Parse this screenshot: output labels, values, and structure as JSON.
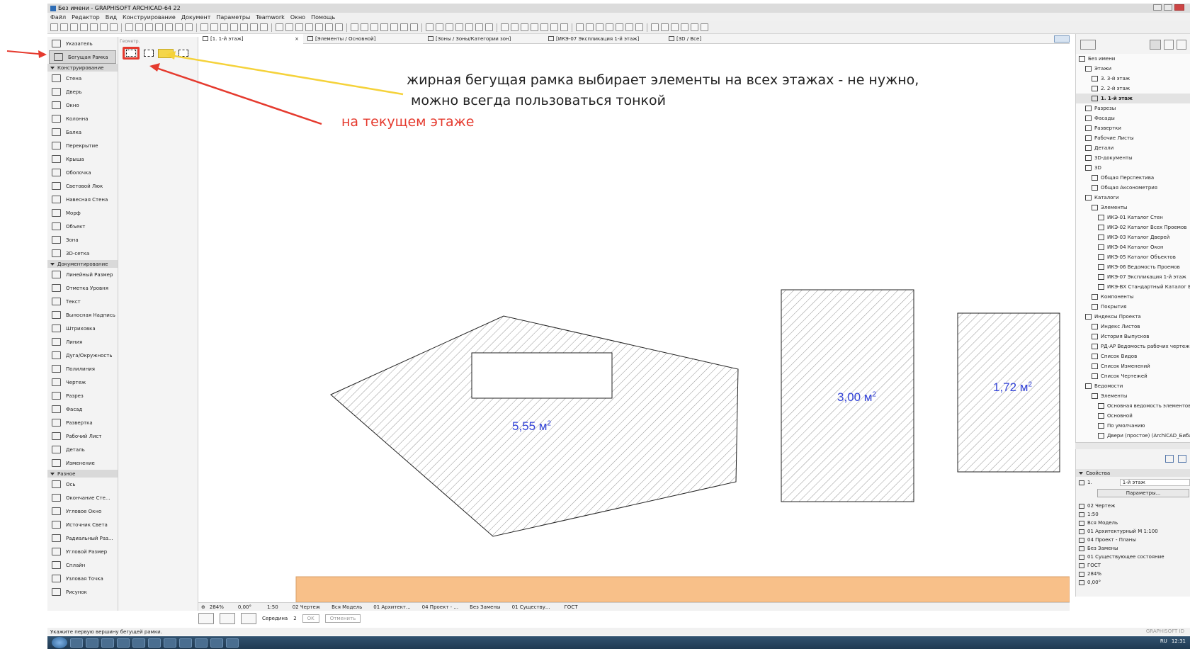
{
  "window": {
    "title": "Без имени - GRAPHISOFT ARCHICAD-64 22"
  },
  "menu": [
    "Файл",
    "Редактор",
    "Вид",
    "Конструирование",
    "Документ",
    "Параметры",
    "Teamwork",
    "Окно",
    "Помощь"
  ],
  "tabs": [
    {
      "label": "[1. 1-й этаж]",
      "close": "×",
      "active": true
    },
    {
      "label": "[Элементы / Основной]"
    },
    {
      "label": "[Зоны / Зоны/Категории зон]"
    },
    {
      "label": "[ИКЭ-07 Экспликация 1-й этаж]"
    },
    {
      "label": "[3D / Все]"
    }
  ],
  "toolbox": {
    "top": [
      {
        "label": "Указатель",
        "icon": "arrow-pointer-icon"
      },
      {
        "label": "Бегущая Рамка",
        "icon": "marquee-icon",
        "selected": true
      }
    ],
    "groups": [
      {
        "label": "Конструирование",
        "items": [
          "Стена",
          "Дверь",
          "Окно",
          "Колонна",
          "Балка",
          "Перекрытие",
          "Крыша",
          "Оболочка",
          "Световой Люк",
          "Навесная Стена",
          "Морф",
          "Объект",
          "Зона",
          "3D-сетка"
        ]
      },
      {
        "label": "Документирование",
        "items": [
          "Линейный Размер",
          "Отметка Уровня",
          "Текст",
          "Выносная Надпись",
          "Штриховка",
          "Линия",
          "Дуга/Окружность",
          "Полилиния",
          "Чертеж",
          "Разрез",
          "Фасад",
          "Развертка",
          "Рабочий Лист",
          "Деталь",
          "Изменение"
        ]
      },
      {
        "label": "Разное",
        "items": [
          "Ось",
          "Окончание Сте...",
          "Угловое Окно",
          "Источник Света",
          "Радиальный Раз...",
          "Угловой Размер",
          "Сплайн",
          "Узловая Точка",
          "Рисунок"
        ]
      }
    ]
  },
  "infobox": {
    "label": "Геометр."
  },
  "annotations": {
    "yellow": "жирная бегущая рамка выбирает элементы на всех этажах - не нужно,",
    "yellow2": "можно всегда пользоваться тонкой",
    "red": "на текущем этаже"
  },
  "zones": [
    {
      "area": "5,55 м"
    },
    {
      "area": "3,00 м"
    },
    {
      "area": "1,72 м"
    }
  ],
  "zone_sup": "2",
  "navigator": [
    {
      "label": "Без имени",
      "indent": 0
    },
    {
      "label": "Этажи",
      "indent": 1
    },
    {
      "label": "3. 3-й этаж",
      "indent": 2
    },
    {
      "label": "2. 2-й этаж",
      "indent": 2
    },
    {
      "label": "1. 1-й этаж",
      "indent": 2,
      "bold": true
    },
    {
      "label": "Разрезы",
      "indent": 1
    },
    {
      "label": "Фасады",
      "indent": 1
    },
    {
      "label": "Развертки",
      "indent": 1
    },
    {
      "label": "Рабочие Листы",
      "indent": 1
    },
    {
      "label": "Детали",
      "indent": 1
    },
    {
      "label": "3D-документы",
      "indent": 1
    },
    {
      "label": "3D",
      "indent": 1
    },
    {
      "label": "Общая Перспектива",
      "indent": 2
    },
    {
      "label": "Общая Аксонометрия",
      "indent": 2
    },
    {
      "label": "Каталоги",
      "indent": 1
    },
    {
      "label": "Элементы",
      "indent": 2
    },
    {
      "label": "ИКЭ-01 Каталог Стен",
      "indent": 3
    },
    {
      "label": "ИКЭ-02 Каталог Всех Проемов",
      "indent": 3
    },
    {
      "label": "ИКЭ-03 Каталог Дверей",
      "indent": 3
    },
    {
      "label": "ИКЭ-04 Каталог Окон",
      "indent": 3
    },
    {
      "label": "ИКЭ-05 Каталог Объектов",
      "indent": 3
    },
    {
      "label": "ИКЭ-06 Ведомость Проемов",
      "indent": 3
    },
    {
      "label": "ИКЭ-07 Экспликация 1-й этаж",
      "indent": 3
    },
    {
      "label": "ИКЭ-ВХ Стандартный Каталог BIM",
      "indent": 3
    },
    {
      "label": "Компоненты",
      "indent": 2
    },
    {
      "label": "Покрытия",
      "indent": 2
    },
    {
      "label": "Индексы Проекта",
      "indent": 1
    },
    {
      "label": "Индекс Листов",
      "indent": 2
    },
    {
      "label": "История Выпусков",
      "indent": 2
    },
    {
      "label": "РД-АР Ведомость рабочих чертежей",
      "indent": 2
    },
    {
      "label": "Список Видов",
      "indent": 2
    },
    {
      "label": "Список Изменений",
      "indent": 2
    },
    {
      "label": "Список Чертежей",
      "indent": 2
    },
    {
      "label": "Ведомости",
      "indent": 1
    },
    {
      "label": "Элементы",
      "indent": 2
    },
    {
      "label": "Основная ведомость элементов",
      "indent": 3
    },
    {
      "label": "Основной",
      "indent": 3
    },
    {
      "label": "По умолчанию",
      "indent": 3
    },
    {
      "label": "Двери (простое) (ArchiCAD_Библиот",
      "indent": 3
    }
  ],
  "properties": {
    "header": "Свойства",
    "num": "1.",
    "name": "1-й этаж",
    "button": "Параметры...",
    "items": [
      "02 Чертеж",
      "1:50",
      "Вся Модель",
      "01 Архитектурный М 1:100",
      "04 Проект - Планы",
      "Без Замены",
      "01 Существующее состояние",
      "ГОСТ",
      "284%",
      "0,00°"
    ]
  },
  "status": {
    "zoom": "284%",
    "angle": "0,00°",
    "scale": "1:50",
    "layer": "02 Чертеж",
    "model": "Вся Модель",
    "pen": "01 Архитект...",
    "view": "04 Проект - ...",
    "override": "Без Замены",
    "reno": "01 Существу...",
    "dim": "ГОСТ",
    "snap": "Середина",
    "snap_num": "2",
    "ok": "OK",
    "cancel": "Отменить"
  },
  "help": "Укажите первую вершину бегущей рамки.",
  "brand": "GRAPHISOFT ID",
  "tray": {
    "lang": "RU",
    "time": "12:31"
  }
}
